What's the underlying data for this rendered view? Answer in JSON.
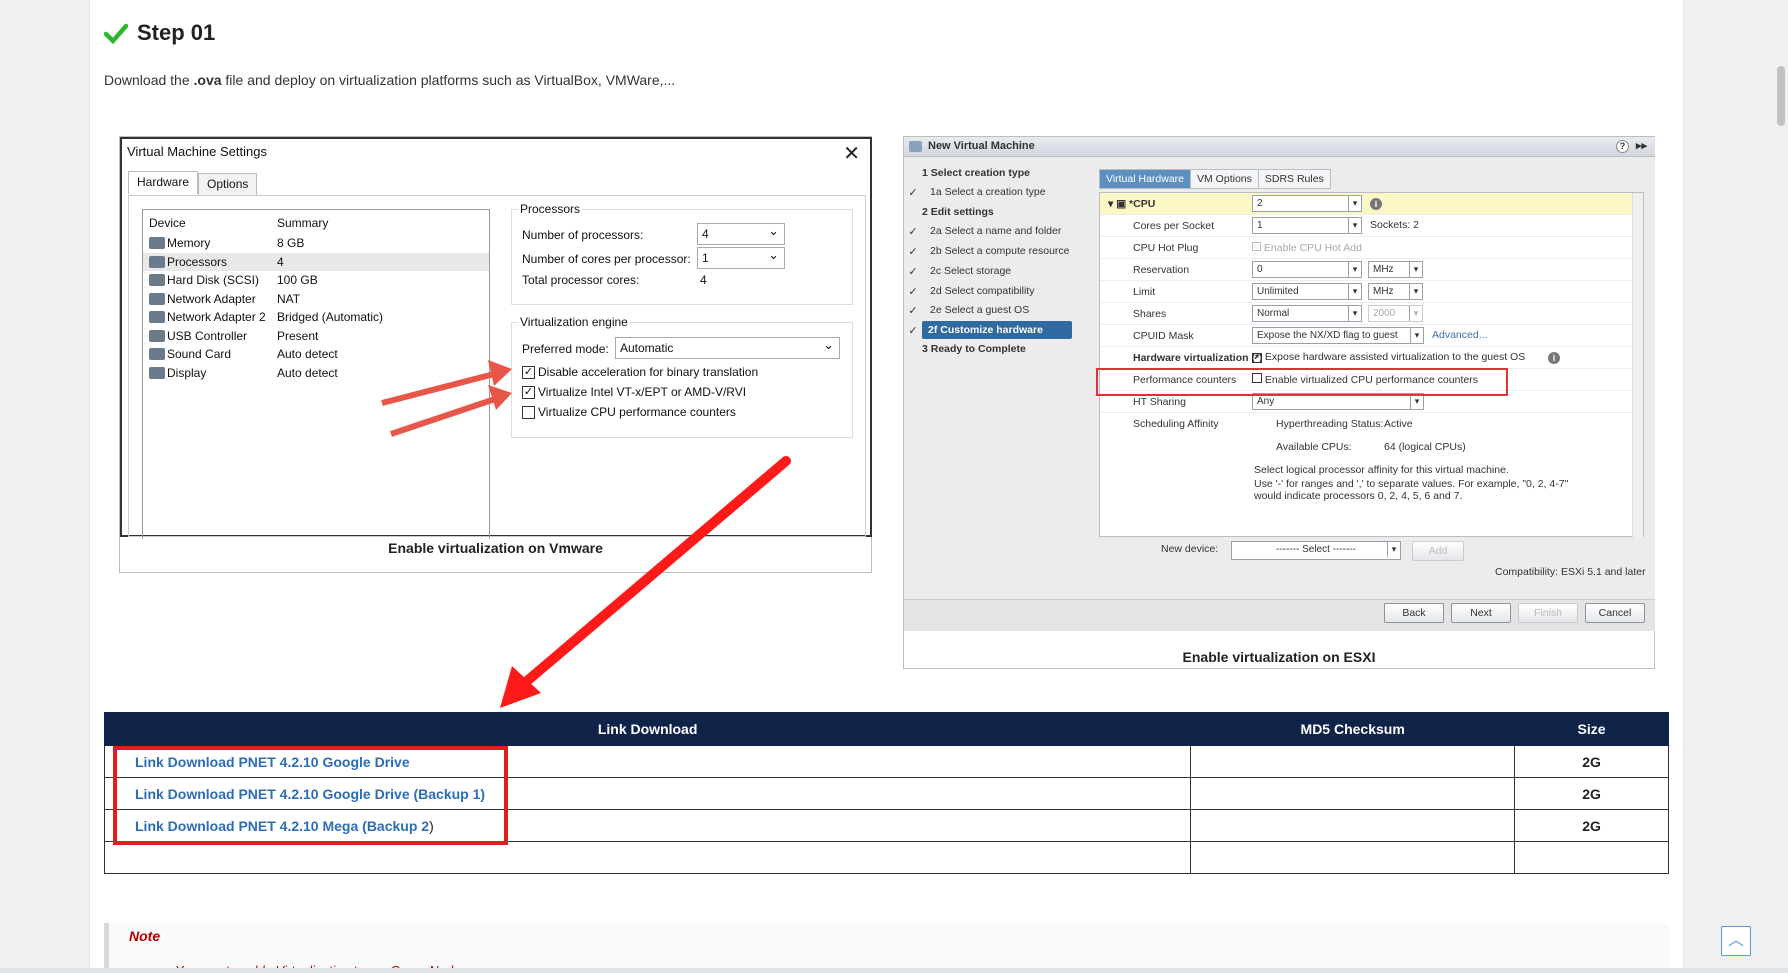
{
  "step": {
    "title": "Step 01"
  },
  "intro": {
    "before": "Download the ",
    "ext": ".ova",
    "after": " file and deploy on virtualization platforms such as VirtualBox, VMWare,..."
  },
  "vmware": {
    "title": "Virtual Machine Settings",
    "tabs": [
      "Hardware",
      "Options"
    ],
    "device_header": "Device",
    "summary_header": "Summary",
    "devices": [
      {
        "name": "Memory",
        "summary": "8 GB"
      },
      {
        "name": "Processors",
        "summary": "4"
      },
      {
        "name": "Hard Disk (SCSI)",
        "summary": "100 GB"
      },
      {
        "name": "Network Adapter",
        "summary": "NAT"
      },
      {
        "name": "Network Adapter 2",
        "summary": "Bridged (Automatic)"
      },
      {
        "name": "USB Controller",
        "summary": "Present"
      },
      {
        "name": "Sound Card",
        "summary": "Auto detect"
      },
      {
        "name": "Display",
        "summary": "Auto detect"
      }
    ],
    "processors_group": "Processors",
    "num_processors_label": "Number of processors:",
    "num_processors_value": "4",
    "cores_label": "Number of cores per processor:",
    "cores_value": "1",
    "total_label": "Total processor cores:",
    "total_value": "4",
    "virt_group": "Virtualization engine",
    "preferred_label": "Preferred mode:",
    "preferred_value": "Automatic",
    "checks": [
      {
        "label": "Disable acceleration for binary translation",
        "checked": true
      },
      {
        "label": "Virtualize Intel VT-x/EPT or AMD-V/RVI",
        "checked": true
      },
      {
        "label": "Virtualize CPU performance counters",
        "checked": false
      }
    ],
    "caption": "Enable virtualization on Vmware"
  },
  "esxi": {
    "title": "New Virtual Machine",
    "wizard": [
      {
        "label": "1 Select creation type",
        "check": false,
        "bold": true
      },
      {
        "label": "1a Select a creation type",
        "check": true
      },
      {
        "label": "2 Edit settings",
        "check": false,
        "bold": true
      },
      {
        "label": "2a Select a name and folder",
        "check": true
      },
      {
        "label": "2b Select a compute resource",
        "check": true
      },
      {
        "label": "2c Select storage",
        "check": true
      },
      {
        "label": "2d Select compatibility",
        "check": true
      },
      {
        "label": "2e Select a guest OS",
        "check": true
      },
      {
        "label": "2f Customize hardware",
        "check": true,
        "selected": true
      },
      {
        "label": "3 Ready to Complete",
        "check": false,
        "bold": true
      }
    ],
    "tabs": [
      "Virtual Hardware",
      "VM Options",
      "SDRS Rules"
    ],
    "cpu_label": "*CPU",
    "cpu_value": "2",
    "cores_label": "Cores per Socket",
    "cores_value": "1",
    "sockets": "Sockets:  2",
    "hotplug_label": "CPU Hot Plug",
    "hotplug_value": "Enable CPU Hot Add",
    "reservation_label": "Reservation",
    "reservation_value": "0",
    "limit_label": "Limit",
    "limit_value": "Unlimited",
    "unit": "MHz",
    "shares_label": "Shares",
    "shares_value": "Normal",
    "shares_num": "2000",
    "cpuid_label": "CPUID Mask",
    "cpuid_value": "Expose the NX/XD flag to guest",
    "advanced": "Advanced...",
    "hwvirt_label": "Hardware virtualization (*)",
    "hwvirt_value": "Expose hardware assisted virtualization to the guest OS",
    "perf_label": "Performance counters",
    "perf_value": "Enable virtualized CPU performance counters",
    "ht_label": "HT Sharing",
    "ht_value": "Any",
    "affinity_label": "Scheduling Affinity",
    "ht_status_label": "Hyperthreading Status:",
    "ht_status_value": "Active",
    "avail_label": "Available CPUs:",
    "avail_value": "64 (logical CPUs)",
    "affinity_help1": "Select logical processor affinity for this virtual machine.",
    "affinity_help2": "Use '-' for ranges and ',' to separate values. For example,  \"0, 2, 4-7\"",
    "affinity_help3": "would indicate processors 0, 2, 4, 5, 6 and 7.",
    "new_device_label": "New device:",
    "new_device_value": "------- Select -------",
    "add": "Add",
    "compat": "Compatibility: ESXi 5.1 and later",
    "buttons": [
      "Back",
      "Next",
      "Finish",
      "Cancel"
    ],
    "caption": "Enable virtualization on ESXI"
  },
  "table": {
    "headers": [
      "Link Download",
      "MD5 Checksum",
      "Size"
    ],
    "rows": [
      {
        "link": "Link Download PNET 4.2.10 Google Drive",
        "md5": "",
        "size": "2G"
      },
      {
        "link": "Link Download PNET 4.2.10 Google Drive (Backup 1)",
        "md5": "",
        "size": "2G"
      },
      {
        "link": "Link Download PNET 4.2.10 Mega (Backup 2",
        "suffix": ")",
        "md5": "",
        "size": "2G"
      }
    ]
  },
  "note": {
    "title": "Note",
    "text": "You must enable Virtualization to run Qemu Node"
  },
  "scroll_top_icon": "chevron-up-icon",
  "colors": {
    "header_bg": "#10244a",
    "link": "#2d6db5",
    "highlight_red": "#e31c1c",
    "check_green": "#2db82d",
    "esxi_selected": "#2f6aa1"
  }
}
